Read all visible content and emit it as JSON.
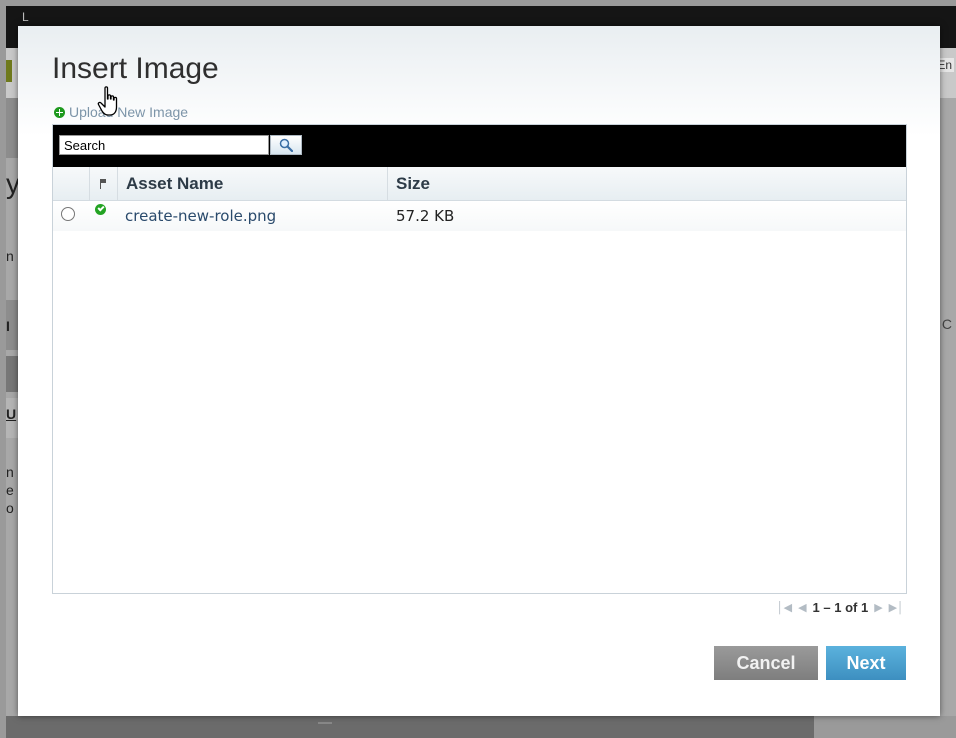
{
  "background": {
    "right_text": "En",
    "right_char": "C",
    "left_chars": [
      "y",
      "n",
      "I",
      "U",
      "n",
      "e",
      "o"
    ]
  },
  "dialog": {
    "title": "Insert Image",
    "upload_link": "Upload New Image",
    "search": {
      "value": "Search",
      "placeholder": ""
    },
    "columns": {
      "asset_name": "Asset Name",
      "size": "Size"
    },
    "rows": [
      {
        "name": "create-new-role.png",
        "size": "57.2 KB",
        "status": "check-icon"
      }
    ],
    "pagination": {
      "text": "1 – 1 of 1"
    },
    "buttons": {
      "cancel": "Cancel",
      "next": "Next"
    }
  },
  "colors": {
    "accent_blue": "#3d8fc0",
    "cancel_gray": "#8a8a8a",
    "status_green": "#23a323",
    "toolbar_black": "#000000"
  }
}
